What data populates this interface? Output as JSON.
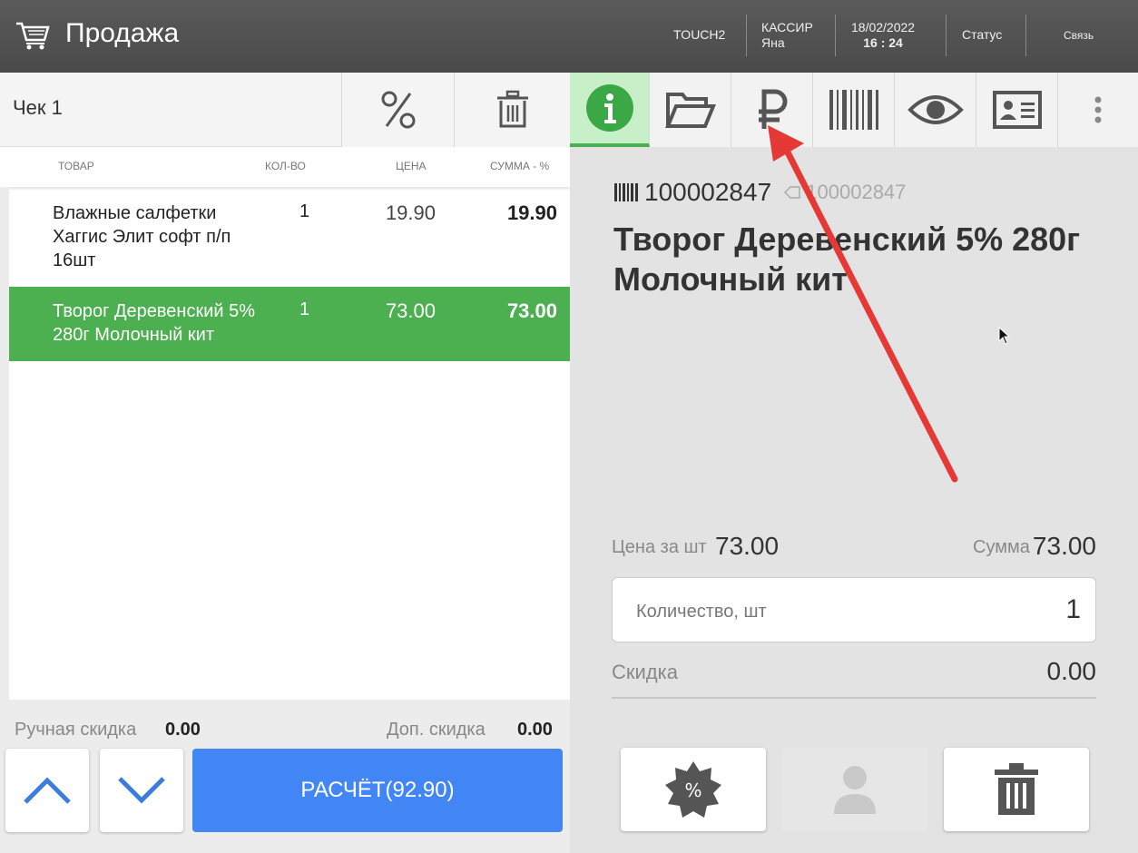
{
  "header": {
    "title": "Продажа",
    "terminal": "TOUCH2",
    "cashier_label": "КАССИР",
    "cashier_name": "Яна",
    "date": "18/02/2022",
    "time": "16 : 24",
    "status_label": "Статус",
    "link_label": "Связь"
  },
  "receipt": {
    "label": "Чек 1",
    "columns": {
      "product": "ТОВАР",
      "qty": "КОЛ-ВО",
      "price": "ЦЕНА",
      "sum": "СУММА - %"
    },
    "items": [
      {
        "name": "Влажные салфетки Хаггис Элит софт п/п 16шт",
        "qty": "1",
        "price": "19.90",
        "sum": "19.90",
        "selected": false
      },
      {
        "name": "Творог Деревенский 5% 280г Молочный кит",
        "qty": "1",
        "price": "73.00",
        "sum": "73.00",
        "selected": true
      }
    ],
    "manual_discount_label": "Ручная скидка",
    "manual_discount_value": "0.00",
    "extra_discount_label": "Доп. скидка",
    "extra_discount_value": "0.00",
    "pay_label": "РАСЧЁТ(92.90)"
  },
  "details": {
    "barcode": "100002847",
    "article": "100002847",
    "product_name": "Творог Деревенский 5% 280г Молочный кит",
    "price_label": "Цена за шт",
    "price_value": "73.00",
    "sum_label": "Сумма",
    "sum_value": "73.00",
    "qty_placeholder": "Количество, шт",
    "qty_value": "1",
    "discount_label": "Скидка",
    "discount_value": "0.00"
  },
  "colors": {
    "accent_green": "#4caf50",
    "accent_blue": "#4285f4",
    "annotation_red": "#e53935",
    "topbar": "#4a4a4a"
  },
  "icons": [
    "cart-icon",
    "percent-icon",
    "trash-icon",
    "info-icon",
    "folder-open-icon",
    "ruble-icon",
    "barcode-icon",
    "eye-icon",
    "id-card-icon",
    "more-vert-icon",
    "chevron-up-icon",
    "chevron-down-icon",
    "discount-badge-icon",
    "person-icon",
    "mouse-cursor-icon"
  ]
}
